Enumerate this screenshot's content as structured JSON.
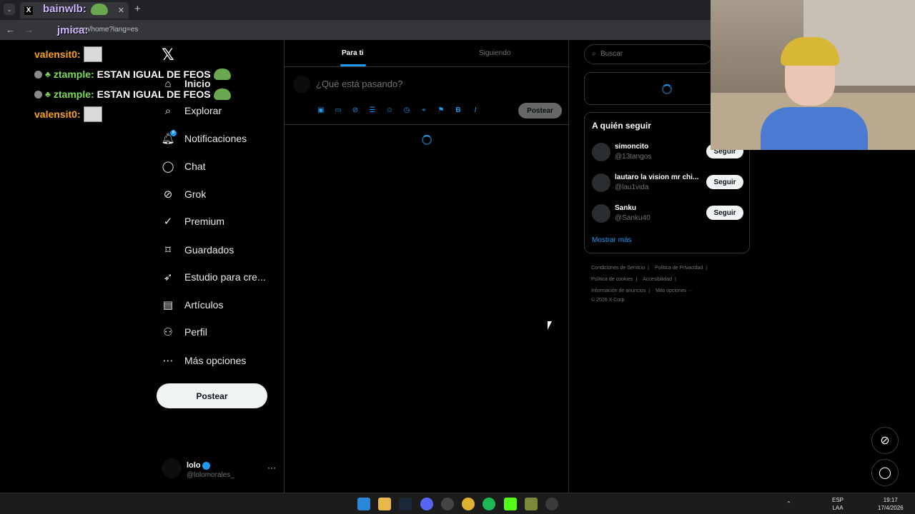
{
  "browser": {
    "tab_title": "bainwlb:",
    "url": "x.com/home?lang=es",
    "url_overlay": "jmica:"
  },
  "chat": [
    {
      "user": "valensit0",
      "message": ""
    },
    {
      "user": "ztample",
      "message": "ESTAN IGUAL DE FEOS"
    },
    {
      "user": "ztample",
      "message": "ESTAN IGUAL DE FEOS"
    },
    {
      "user": "valensit0",
      "message": ""
    }
  ],
  "sidebar": {
    "items": [
      {
        "label": "Inicio",
        "icon": "home-icon"
      },
      {
        "label": "Explorar",
        "icon": "search-icon"
      },
      {
        "label": "Notificaciones",
        "icon": "bell-icon",
        "badge": "8"
      },
      {
        "label": "Chat",
        "icon": "chat-icon"
      },
      {
        "label": "Grok",
        "icon": "grok-icon"
      },
      {
        "label": "Premium",
        "icon": "premium-icon"
      },
      {
        "label": "Guardados",
        "icon": "bookmark-icon"
      },
      {
        "label": "Estudio para cre...",
        "icon": "rocket-icon"
      },
      {
        "label": "Artículos",
        "icon": "article-icon"
      },
      {
        "label": "Perfil",
        "icon": "person-icon"
      },
      {
        "label": "Más opciones",
        "icon": "more-icon"
      }
    ],
    "post_button": "Postear",
    "user": {
      "name": "lolo",
      "handle": "@lolomorales_"
    }
  },
  "main": {
    "tabs": [
      "Para ti",
      "Siguiendo"
    ],
    "compose_placeholder": "¿Qué está pasando?",
    "compose_post": "Postear"
  },
  "right": {
    "search_placeholder": "Buscar",
    "who_to_follow": {
      "title": "A quién seguir",
      "accounts": [
        {
          "name": "simoncito",
          "handle": "@13tangos",
          "button": "Seguir"
        },
        {
          "name": "lautaro la vision mr chi...",
          "handle": "@lau1vida",
          "button": "Seguir"
        },
        {
          "name": "Sanku",
          "handle": "@Sanku40",
          "button": "Seguir"
        }
      ],
      "show_more": "Mostrar más"
    },
    "footer": {
      "links": [
        "Condiciones de Servicio",
        "Política de Privacidad",
        "Política de cookies",
        "Accesibilidad",
        "Información de anuncios",
        "Más opciones ···"
      ],
      "copyright": "© 2026 X Corp."
    }
  },
  "taskbar": {
    "lang": "ESP",
    "region": "LAA",
    "time": "19:17",
    "date": "17/4/2026"
  },
  "colors": {
    "accent": "#1d9bf0",
    "background": "#000000",
    "border": "#2f3336"
  }
}
